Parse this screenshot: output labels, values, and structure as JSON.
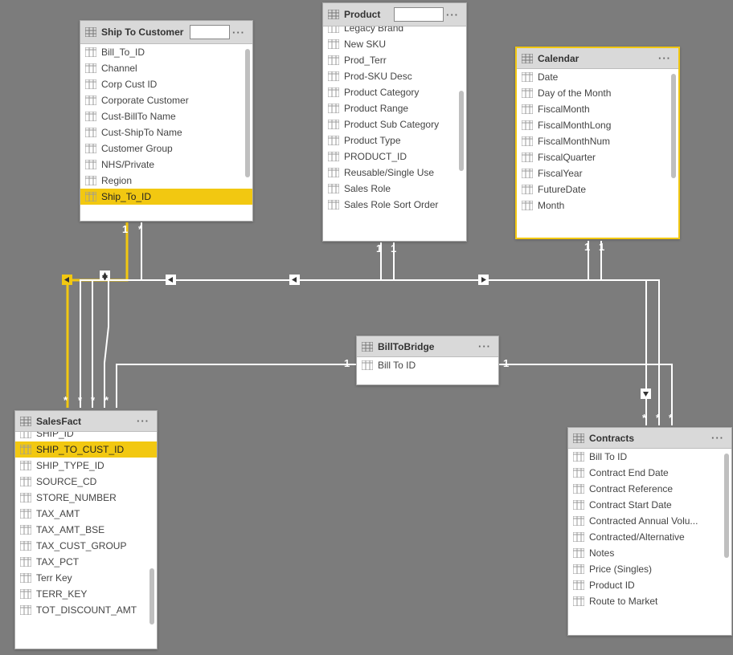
{
  "tables": {
    "shipTo": {
      "title": "Ship To Customer",
      "fields": [
        {
          "label": "Bill_To_ID"
        },
        {
          "label": "Channel"
        },
        {
          "label": "Corp Cust ID"
        },
        {
          "label": "Corporate Customer"
        },
        {
          "label": "Cust-BillTo Name"
        },
        {
          "label": "Cust-ShipTo Name"
        },
        {
          "label": "Customer Group"
        },
        {
          "label": "NHS/Private"
        },
        {
          "label": "Region"
        },
        {
          "label": "Ship_To_ID",
          "selected": true
        }
      ]
    },
    "product": {
      "title": "Product",
      "fields": [
        {
          "label": "Legacy Brand"
        },
        {
          "label": "New SKU"
        },
        {
          "label": "Prod_Terr"
        },
        {
          "label": "Prod-SKU Desc"
        },
        {
          "label": "Product Category"
        },
        {
          "label": "Product Range"
        },
        {
          "label": "Product Sub Category"
        },
        {
          "label": "Product Type"
        },
        {
          "label": "PRODUCT_ID"
        },
        {
          "label": "Reusable/Single Use"
        },
        {
          "label": "Sales Role"
        },
        {
          "label": "Sales Role Sort Order"
        }
      ]
    },
    "calendar": {
      "title": "Calendar",
      "fields": [
        {
          "label": "Date"
        },
        {
          "label": "Day of the Month"
        },
        {
          "label": "FiscalMonth"
        },
        {
          "label": "FiscalMonthLong"
        },
        {
          "label": "FiscalMonthNum"
        },
        {
          "label": "FiscalQuarter"
        },
        {
          "label": "FiscalYear"
        },
        {
          "label": "FutureDate"
        },
        {
          "label": "Month"
        }
      ]
    },
    "billToBridge": {
      "title": "BillToBridge",
      "fields": [
        {
          "label": "Bill To ID"
        }
      ]
    },
    "salesFact": {
      "title": "SalesFact",
      "fields": [
        {
          "label": "SHIP_ID"
        },
        {
          "label": "SHIP_TO_CUST_ID",
          "selected": true
        },
        {
          "label": "SHIP_TYPE_ID"
        },
        {
          "label": "SOURCE_CD"
        },
        {
          "label": "STORE_NUMBER"
        },
        {
          "label": "TAX_AMT"
        },
        {
          "label": "TAX_AMT_BSE"
        },
        {
          "label": "TAX_CUST_GROUP"
        },
        {
          "label": "TAX_PCT"
        },
        {
          "label": "Terr Key"
        },
        {
          "label": "TERR_KEY"
        },
        {
          "label": "TOT_DISCOUNT_AMT"
        }
      ]
    },
    "contracts": {
      "title": "Contracts",
      "fields": [
        {
          "label": "Bill To ID"
        },
        {
          "label": "Contract End Date"
        },
        {
          "label": "Contract Reference"
        },
        {
          "label": "Contract Start Date"
        },
        {
          "label": "Contracted Annual Volu..."
        },
        {
          "label": "Contracted/Alternative"
        },
        {
          "label": "Notes"
        },
        {
          "label": "Price (Singles)"
        },
        {
          "label": "Product ID"
        },
        {
          "label": "Route to Market"
        }
      ]
    }
  },
  "cardinality": {
    "one": "1",
    "many": "*"
  }
}
